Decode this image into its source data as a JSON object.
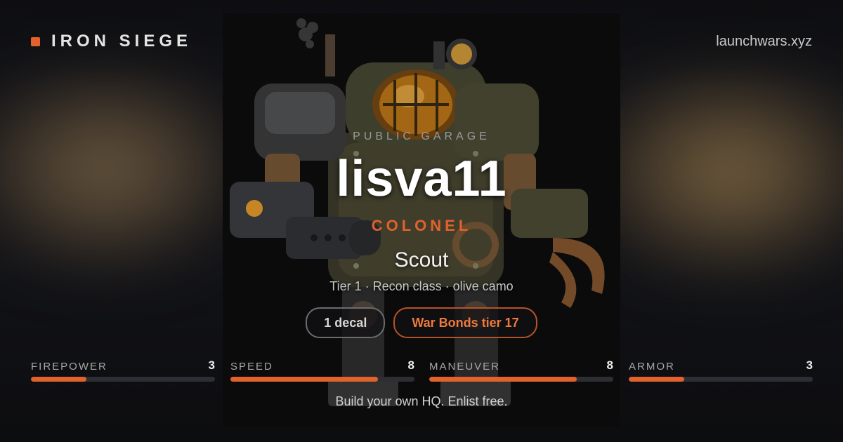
{
  "brand": {
    "name": "IRON SIEGE",
    "site": "launchwars.xyz"
  },
  "card": {
    "eyebrow": "PUBLIC GARAGE",
    "username": "lisva11",
    "rank": "COLONEL",
    "vehicle": "Scout",
    "meta": "Tier 1 · Recon class · olive camo",
    "badges": [
      "1 decal",
      "War Bonds tier 17"
    ]
  },
  "stats": [
    {
      "label": "FIREPOWER",
      "value": 3,
      "level": 0.3
    },
    {
      "label": "SPEED",
      "value": 8,
      "level": 0.8
    },
    {
      "label": "MANEUVER",
      "value": 8,
      "level": 0.8
    },
    {
      "label": "ARMOR",
      "value": 3,
      "level": 0.3
    }
  ],
  "cta": "Build your own HQ. Enlist free.",
  "colors": {
    "accent": "#e2612c",
    "background": "#121317",
    "bar_track": "#2c2e33"
  },
  "icons": {
    "brand_mark": "square-dot-icon",
    "art": "steampunk-mech-illustration"
  }
}
